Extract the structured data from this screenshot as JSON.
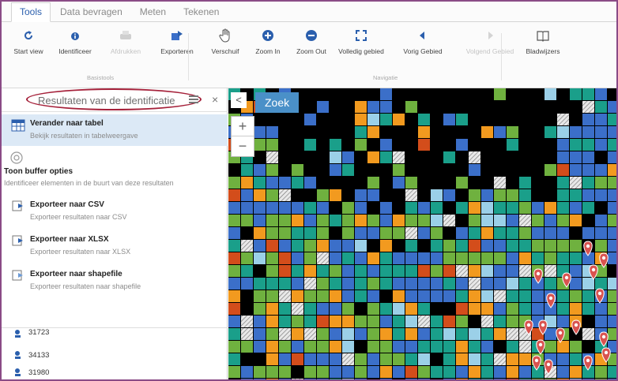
{
  "tabs": [
    "Tools",
    "Data bevragen",
    "Meten",
    "Tekenen"
  ],
  "toolbar": {
    "items": [
      {
        "label": "Start view",
        "icon": "refresh-icon",
        "enabled": true
      },
      {
        "label": "Identificeer",
        "icon": "identify-icon",
        "enabled": true
      },
      {
        "label": "Afdrukken",
        "icon": "print-icon",
        "enabled": false
      },
      {
        "label": "Exporteren",
        "icon": "export-icon",
        "enabled": true
      },
      {
        "label": "Verschuif",
        "icon": "pan-hand-icon",
        "enabled": true
      },
      {
        "label": "Zoom In",
        "icon": "zoom-in-icon",
        "enabled": true
      },
      {
        "label": "Zoom Out",
        "icon": "zoom-out-icon",
        "enabled": true
      },
      {
        "label": "Volledig gebied",
        "icon": "full-extent-icon",
        "enabled": true
      },
      {
        "label": "Vorig Gebied",
        "icon": "previous-extent-icon",
        "enabled": true
      },
      {
        "label": "Volgend Gebied",
        "icon": "next-extent-icon",
        "enabled": false
      },
      {
        "label": "Bladwijzers",
        "icon": "bookmark-icon",
        "enabled": true
      }
    ],
    "groups": [
      "Basistools",
      "Navigatie"
    ]
  },
  "panel": {
    "title": "Resultaten van de identificatie",
    "options": [
      {
        "title": "Verander naar tabel",
        "desc": "Bekijk resultaten in tabelweergave",
        "icon": "table-icon",
        "selected": true
      },
      {
        "title": "Toon buffer opties",
        "desc": "Identificeer elementen in de buurt van deze resultaten",
        "icon": "buffer-icon",
        "selected": false
      },
      {
        "title": "Exporteer naar CSV",
        "desc": "Exporteer resultaten naar CSV",
        "icon": "csv-export-icon",
        "selected": false
      },
      {
        "title": "Exporteer naar XLSX",
        "desc": "Exporteer resultaten naar XLSX",
        "icon": "xlsx-export-icon",
        "selected": false
      },
      {
        "title": "Exporteer naar shapefile",
        "desc": "Exporteer resultaten naar shapefile",
        "icon": "shapefile-export-icon",
        "selected": false
      }
    ],
    "results": [
      "31723",
      "34133",
      "31980"
    ]
  },
  "map": {
    "search_label": "Zoek",
    "collapse_glyph": "<",
    "zoom_in": "+",
    "zoom_out": "−"
  },
  "colors": {
    "accent": "#2b5fad",
    "selected_row": "#dce9f6",
    "highlight": "#a5213a",
    "marker": "#d9534f",
    "palette": [
      "#3b6fc9",
      "#1a9f8a",
      "#6fb13f",
      "#f29a1f",
      "#d34d1b",
      "#9bd0e8",
      "#000000"
    ]
  }
}
